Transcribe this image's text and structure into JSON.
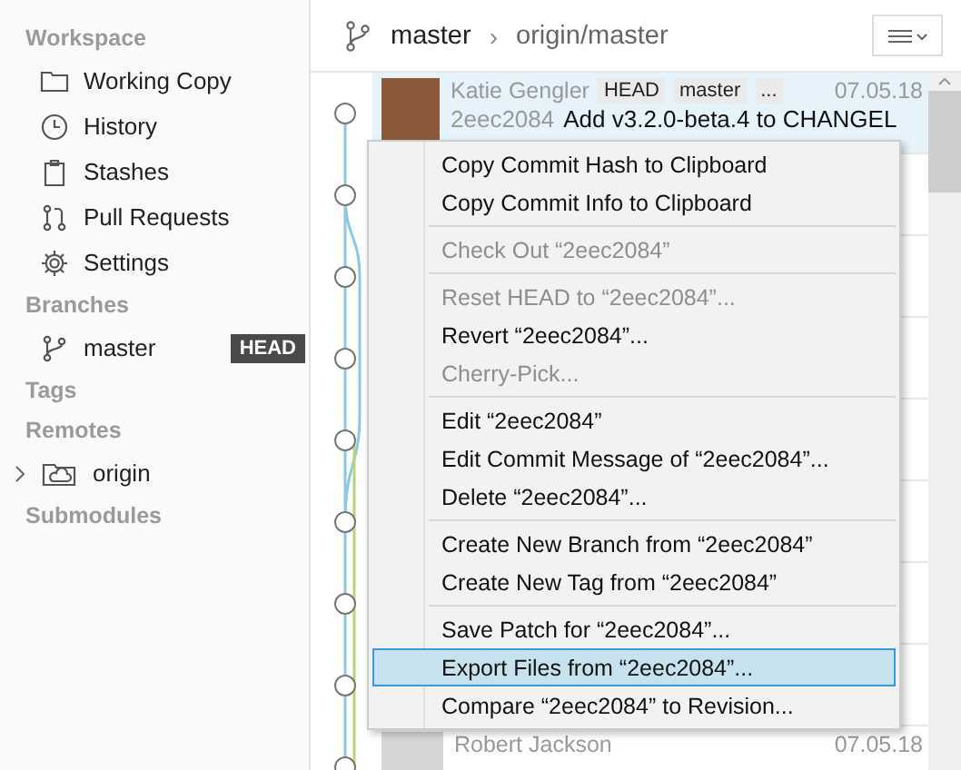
{
  "sidebar": {
    "sections": [
      {
        "title": "Workspace",
        "items": [
          {
            "label": "Working Copy"
          },
          {
            "label": "History"
          },
          {
            "label": "Stashes"
          },
          {
            "label": "Pull Requests"
          },
          {
            "label": "Settings"
          }
        ]
      },
      {
        "title": "Branches",
        "items": [
          {
            "label": "master",
            "badge": "HEAD"
          }
        ]
      },
      {
        "title": "Tags"
      },
      {
        "title": "Remotes",
        "items": [
          {
            "label": "origin",
            "expanded": false
          }
        ]
      },
      {
        "title": "Submodules"
      }
    ]
  },
  "header": {
    "branch": "master",
    "separator": "›",
    "upstream": "origin/master"
  },
  "commits": [
    {
      "author": "Katie Gengler",
      "badges": [
        "HEAD",
        "master",
        "..."
      ],
      "date": "07.05.18",
      "hash": "2eec2084",
      "message": "Add v3.2.0-beta.4 to CHANGEL",
      "selected": true,
      "kind": "photo"
    },
    {
      "selected": false
    },
    {
      "selected": false
    },
    {
      "selected": false
    },
    {
      "selected": false
    },
    {
      "selected": false
    },
    {
      "selected": false
    },
    {
      "selected": false
    },
    {
      "author": "Robert Jackson",
      "date": "07.05.18",
      "selected": false,
      "kind": "silhouette"
    }
  ],
  "context_menu": [
    {
      "kind": "item",
      "label": "Copy Commit Hash to Clipboard",
      "disabled": false,
      "selected": false
    },
    {
      "kind": "item",
      "label": "Copy Commit Info to Clipboard",
      "disabled": false,
      "selected": false
    },
    {
      "kind": "separator"
    },
    {
      "kind": "item",
      "label": "Check Out “2eec2084”",
      "disabled": true,
      "selected": false
    },
    {
      "kind": "separator"
    },
    {
      "kind": "item",
      "label": "Reset HEAD to “2eec2084”...",
      "disabled": true,
      "selected": false
    },
    {
      "kind": "item",
      "label": "Revert “2eec2084”...",
      "disabled": false,
      "selected": false
    },
    {
      "kind": "item",
      "label": "Cherry-Pick...",
      "disabled": true,
      "selected": false
    },
    {
      "kind": "separator"
    },
    {
      "kind": "item",
      "label": "Edit “2eec2084”",
      "disabled": false,
      "selected": false
    },
    {
      "kind": "item",
      "label": "Edit Commit Message of “2eec2084”...",
      "disabled": false,
      "selected": false
    },
    {
      "kind": "item",
      "label": "Delete “2eec2084”...",
      "disabled": false,
      "selected": false
    },
    {
      "kind": "separator"
    },
    {
      "kind": "item",
      "label": "Create New Branch from “2eec2084”",
      "disabled": false,
      "selected": false
    },
    {
      "kind": "item",
      "label": "Create New Tag from “2eec2084”",
      "disabled": false,
      "selected": false
    },
    {
      "kind": "separator"
    },
    {
      "kind": "item",
      "label": "Save Patch for “2eec2084”...",
      "disabled": false,
      "selected": false
    },
    {
      "kind": "item",
      "label": "Export Files from “2eec2084”...",
      "disabled": false,
      "selected": true
    },
    {
      "kind": "item",
      "label": "Compare “2eec2084” to Revision...",
      "disabled": false,
      "selected": false
    }
  ]
}
